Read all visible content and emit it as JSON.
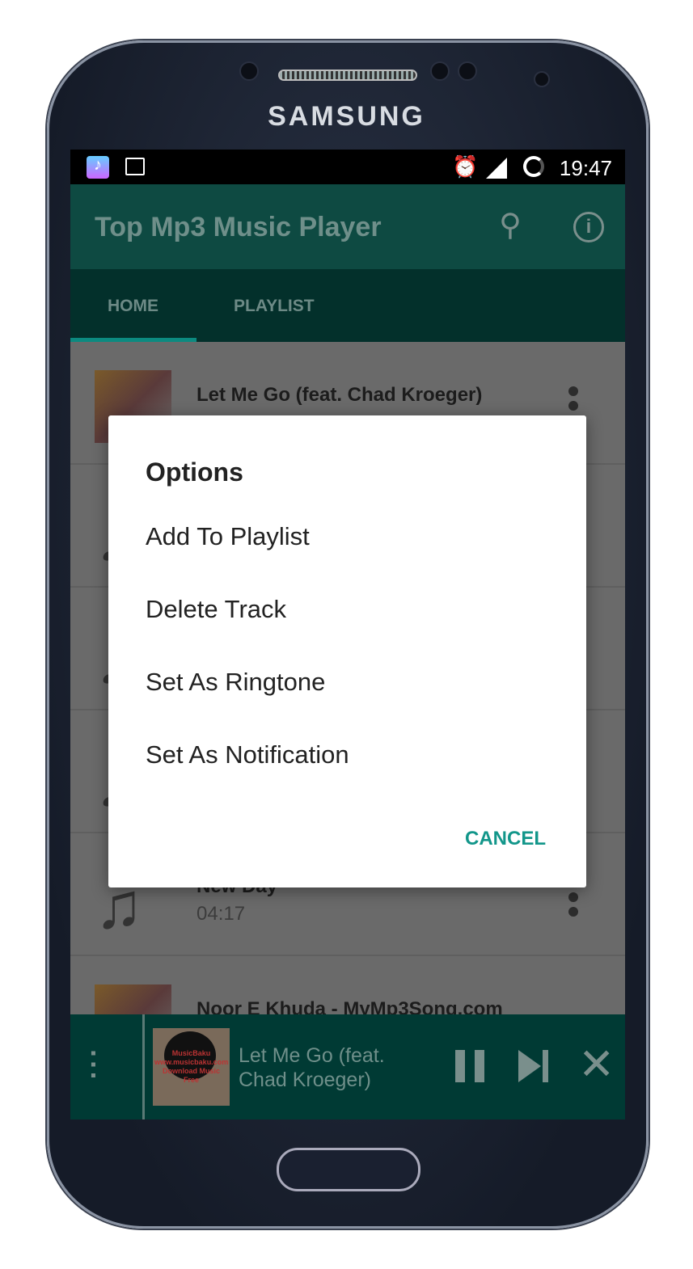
{
  "device": {
    "brand": "SAMSUNG"
  },
  "status_bar": {
    "time": "19:47",
    "icons": [
      "music-app-icon",
      "image-icon",
      "alarm-icon",
      "signal-icon",
      "loading-icon"
    ]
  },
  "toolbar": {
    "title": "Top Mp3 Music Player",
    "icons": [
      "search-icon",
      "info-icon"
    ]
  },
  "tabs": [
    {
      "label": "HOME",
      "active": true
    },
    {
      "label": "PLAYLIST",
      "active": false
    }
  ],
  "tracks": [
    {
      "title": "Let Me Go (feat. Chad Kroeger)",
      "art": "album-art"
    },
    {
      "title": "",
      "art": "music-note"
    },
    {
      "title": "",
      "art": "music-note"
    },
    {
      "title": "",
      "art": "music-note"
    },
    {
      "title": "New Day",
      "duration": "04:17",
      "art": "music-note"
    },
    {
      "title": "Noor E Khuda - MyMp3Song.com",
      "art": "album-art"
    }
  ],
  "dialog": {
    "title": "Options",
    "options": [
      "Add To Playlist",
      "Delete Track",
      "Set As Ringtone",
      "Set As Notification"
    ],
    "cancel": "CANCEL"
  },
  "player": {
    "title": "Let Me Go (feat. Chad Kroeger)",
    "art_text": "MusicBaku www.musicbaku.com Download Music Free"
  },
  "colors": {
    "primary": "#00897b",
    "accent": "#12968a"
  }
}
